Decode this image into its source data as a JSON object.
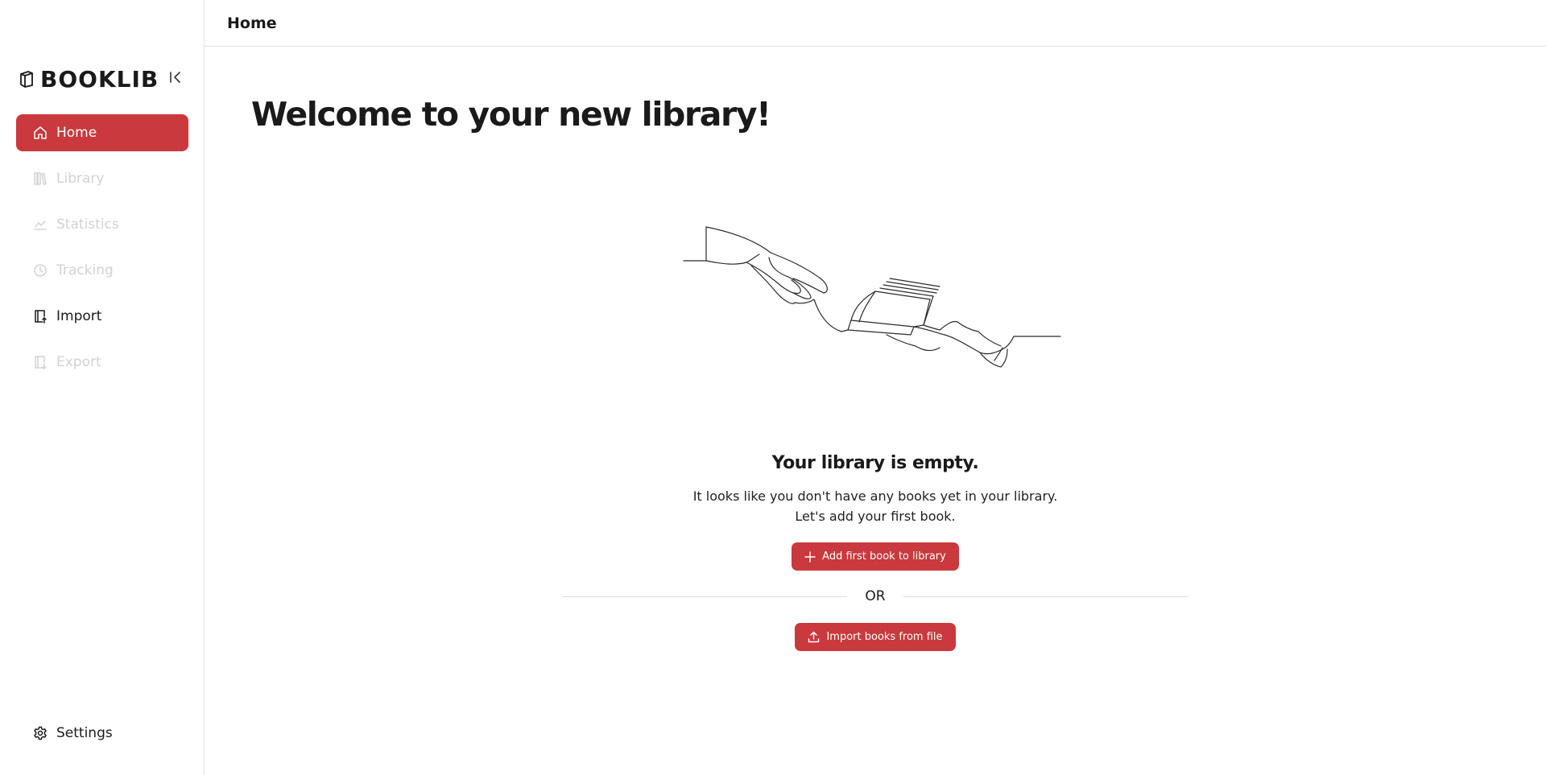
{
  "brand": {
    "name": "BOOKLIB"
  },
  "sidebar": {
    "items": [
      {
        "label": "Home",
        "icon": "home-icon",
        "state": "active"
      },
      {
        "label": "Library",
        "icon": "library-icon",
        "state": "disabled"
      },
      {
        "label": "Statistics",
        "icon": "chart-icon",
        "state": "disabled"
      },
      {
        "label": "Tracking",
        "icon": "clock-icon",
        "state": "disabled"
      },
      {
        "label": "Import",
        "icon": "import-icon",
        "state": "normal"
      },
      {
        "label": "Export",
        "icon": "export-icon",
        "state": "disabled"
      }
    ],
    "settings_label": "Settings"
  },
  "header": {
    "title": "Home"
  },
  "main": {
    "title": "Welcome to your new library!",
    "empty_title": "Your library is empty.",
    "empty_line1": "It looks like you don't have any books yet in your library.",
    "empty_line2": "Let's add your first book.",
    "add_button_label": "Add first book to library",
    "divider_label": "OR",
    "import_button_label": "Import books from file"
  },
  "colors": {
    "accent": "#c9393d",
    "disabled_text": "#d2d2d2",
    "border": "#e4e4e4"
  }
}
